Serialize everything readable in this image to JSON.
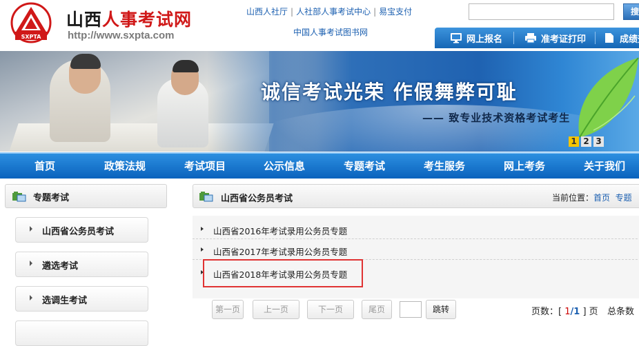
{
  "header": {
    "title_plain": "山西",
    "title_red": "人事考试网",
    "url": "http://www.sxpta.com",
    "logo_text": "SXPTA",
    "top_links": [
      "山西人社厅",
      "人社部人事考试中心",
      "易宝支付"
    ],
    "book_link": "中国人事考试图书网",
    "search": {
      "placeholder": "",
      "button_label": "搜"
    },
    "quick_links": [
      "网上报名",
      "准考证打印",
      "成绩查"
    ]
  },
  "banner": {
    "slogan": "诚信考试光荣  作假舞弊可耻",
    "sub": "—— 致专业技术资格考试考生",
    "slides": [
      "1",
      "2",
      "3"
    ],
    "active_slide": 1,
    "accent": "#f5c400"
  },
  "nav": [
    "首页",
    "政策法规",
    "考试项目",
    "公示信息",
    "专题考试",
    "考生服务",
    "网上考务",
    "关于我们"
  ],
  "sidebar": {
    "title": "专题考试",
    "items": [
      "山西省公务员考试",
      "遴选考试",
      "选调生考试"
    ]
  },
  "main": {
    "title": "山西省公务员考试",
    "crumb_label": "当前位置：",
    "crumb_home": "首页",
    "crumb_next": "专题",
    "articles": [
      "山西省2016年考试录用公务员专题",
      "山西省2017年考试录用公务员专题",
      "山西省2018年考试录用公务员专题"
    ],
    "highlighted_index": 2
  },
  "pager": {
    "first": "第一页",
    "prev": "上一页",
    "next": "下一页",
    "last": "尾页",
    "jump": "跳转",
    "pages_label": "页数：",
    "bracket_open": "[",
    "current": "1",
    "slash": "/",
    "total_pages": "1",
    "bracket_close": "]",
    "page_unit": "页",
    "total_label": "总条数"
  },
  "colors": {
    "nav": "#0a62bd",
    "link": "#1b5fb0",
    "brand_red": "#d01818",
    "highlight": "#e03232"
  }
}
